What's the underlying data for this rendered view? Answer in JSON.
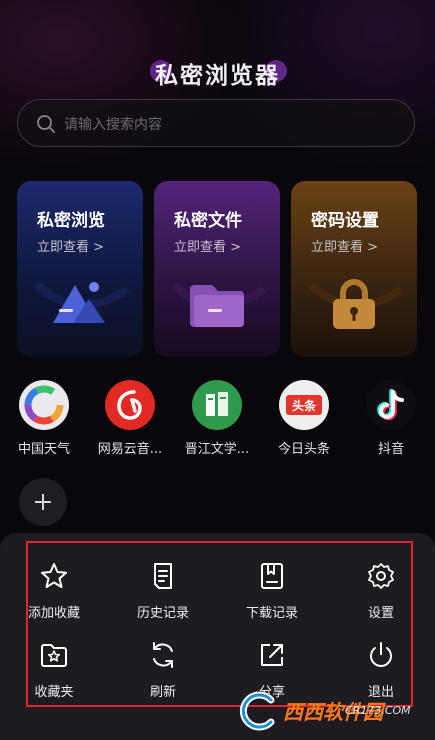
{
  "header": {
    "title": "私密浏览器"
  },
  "search": {
    "placeholder": "请输入搜索内容"
  },
  "cards": [
    {
      "title": "私密浏览",
      "sub": "立即查看 >",
      "icon": "mountain-lock-icon"
    },
    {
      "title": "私密文件",
      "sub": "立即查看 >",
      "icon": "folder-icon"
    },
    {
      "title": "密码设置",
      "sub": "立即查看 >",
      "icon": "padlock-icon"
    }
  ],
  "apps": [
    {
      "label": "中国天气",
      "icon": "china-weather-icon"
    },
    {
      "label": "网易云音...",
      "icon": "netease-music-icon"
    },
    {
      "label": "晋江文学...",
      "icon": "jinjiang-literature-icon"
    },
    {
      "label": "今日头条",
      "icon": "toutiao-icon",
      "badge": "头条"
    },
    {
      "label": "抖音",
      "icon": "douyin-icon"
    }
  ],
  "menu": [
    {
      "label": "添加收藏",
      "icon": "star-icon"
    },
    {
      "label": "历史记录",
      "icon": "history-doc-icon"
    },
    {
      "label": "下载记录",
      "icon": "bookmark-book-icon"
    },
    {
      "label": "设置",
      "icon": "gear-icon"
    },
    {
      "label": "收藏夹",
      "icon": "star-folder-icon"
    },
    {
      "label": "刷新",
      "icon": "refresh-icon"
    },
    {
      "label": "分享",
      "icon": "share-icon"
    },
    {
      "label": "退出",
      "icon": "power-icon"
    }
  ],
  "watermark": {
    "text": "西西软件园",
    "url": "CR173.COM"
  },
  "colors": {
    "highlight_border": "#e0262a",
    "sheet_bg": "#1e1b21"
  }
}
